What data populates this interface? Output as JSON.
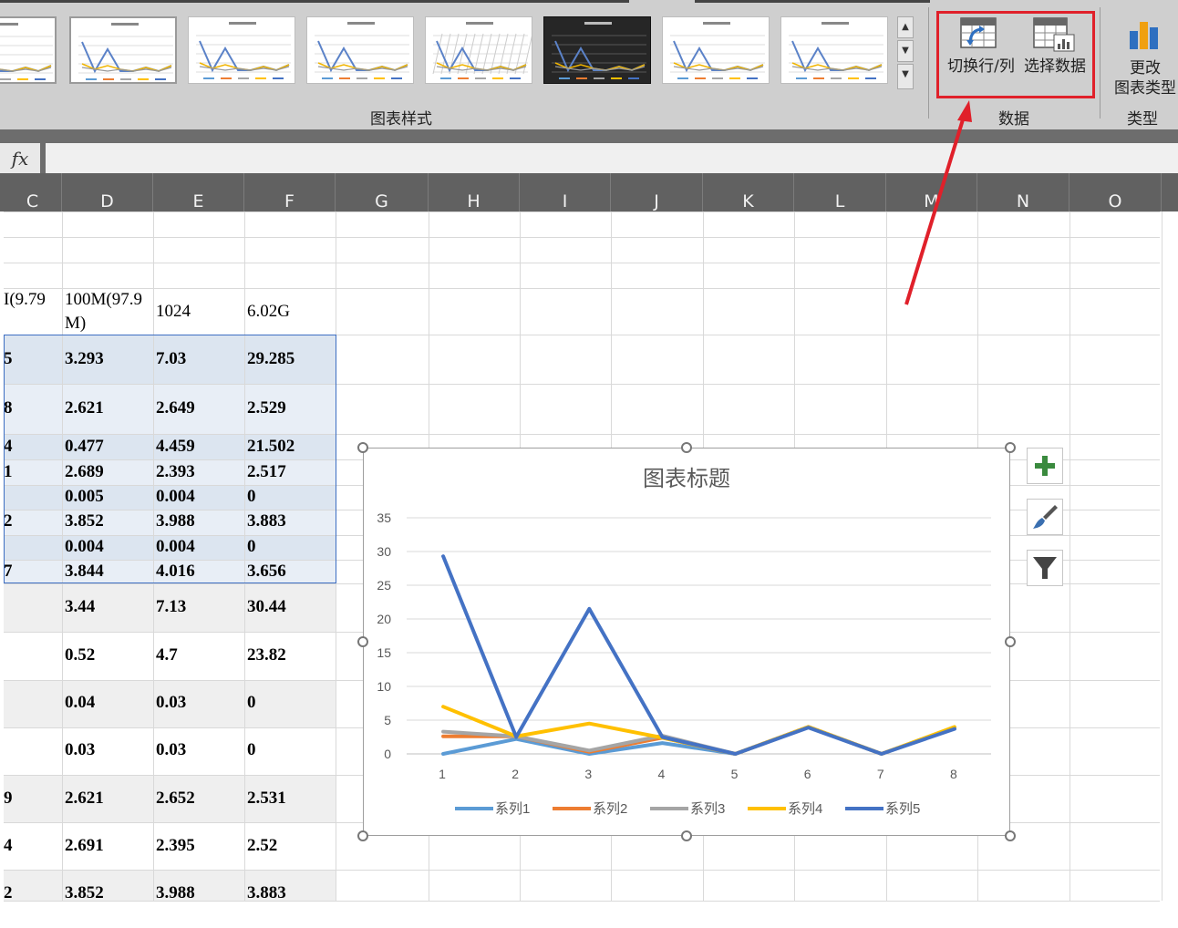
{
  "ribbon": {
    "chart_styles_group_label": "图表样式",
    "data_group_label": "数据",
    "type_group_label": "类型",
    "switch_row_col_label": "切换行/列",
    "select_data_label": "选择数据",
    "change_type_label_1": "更改",
    "change_type_label_2": "图表类型",
    "scroll_up_icon": "chevron-up-icon",
    "scroll_down_icon": "chevron-down-icon",
    "more_icon": "more-styles-icon",
    "highlight_color": "#e0202a"
  },
  "formula_bar": {
    "fx_label": "fx",
    "value": ""
  },
  "columns": [
    "C",
    "D",
    "E",
    "F",
    "G",
    "H",
    "I",
    "J",
    "K",
    "L",
    "M",
    "N",
    "O"
  ],
  "sheet": {
    "header_row": {
      "c": "I(9.79",
      "d1": "100M(97.9",
      "d2": "M)",
      "e": "1024",
      "f": "6.02G"
    },
    "rows": [
      {
        "c": "5",
        "d": "3.293",
        "e": "7.03",
        "f": "29.285"
      },
      {
        "c": "8",
        "d": "2.621",
        "e": "2.649",
        "f": "2.529"
      },
      {
        "c": "4",
        "d": "0.477",
        "e": "4.459",
        "f": "21.502"
      },
      {
        "c": "1",
        "d": "2.689",
        "e": "2.393",
        "f": "2.517"
      },
      {
        "c": "",
        "d": "0.005",
        "e": "0.004",
        "f": "0"
      },
      {
        "c": "2",
        "d": "3.852",
        "e": "3.988",
        "f": "3.883"
      },
      {
        "c": "",
        "d": "0.004",
        "e": "0.004",
        "f": "0"
      },
      {
        "c": "7",
        "d": "3.844",
        "e": "4.016",
        "f": "3.656"
      },
      {
        "c": "",
        "d": "3.44",
        "e": "7.13",
        "f": "30.44"
      },
      {
        "c": "",
        "d": "0.52",
        "e": "4.7",
        "f": "23.82"
      },
      {
        "c": "",
        "d": "0.04",
        "e": "0.03",
        "f": "0"
      },
      {
        "c": "",
        "d": "0.03",
        "e": "0.03",
        "f": "0"
      },
      {
        "c": "9",
        "d": "2.621",
        "e": "2.652",
        "f": "2.531"
      },
      {
        "c": "4",
        "d": "2.691",
        "e": "2.395",
        "f": "2.52"
      },
      {
        "c": "2",
        "d": "3.852",
        "e": "3.988",
        "f": "3.883"
      }
    ]
  },
  "chart_side_buttons": [
    {
      "name": "add-element-button",
      "icon": "plus-icon",
      "color": "#3a8a3e"
    },
    {
      "name": "chart-style-button",
      "icon": "paintbrush-icon",
      "color": "#3a6fb0"
    },
    {
      "name": "chart-filter-button",
      "icon": "filter-icon",
      "color": "#444444"
    }
  ],
  "chart_data": {
    "type": "line",
    "title": "图表标题",
    "categories": [
      "1",
      "2",
      "3",
      "4",
      "5",
      "6",
      "7",
      "8"
    ],
    "ylim": [
      0,
      35
    ],
    "yticks": [
      0,
      5,
      10,
      15,
      20,
      25,
      30,
      35
    ],
    "grid": true,
    "legend": "bottom",
    "series": [
      {
        "name": "系列1",
        "color": "#5b9bd5",
        "values": [
          0,
          2.2,
          0,
          1.6,
          0,
          4,
          0,
          3.8
        ]
      },
      {
        "name": "系列2",
        "color": "#ed7d31",
        "values": [
          2.6,
          2.6,
          0.3,
          2.4,
          0,
          4,
          0,
          3.9
        ]
      },
      {
        "name": "系列3",
        "color": "#a5a5a5",
        "values": [
          3.3,
          2.6,
          0.5,
          2.7,
          0,
          4,
          0,
          3.9
        ]
      },
      {
        "name": "系列4",
        "color": "#ffc000",
        "values": [
          7.0,
          2.6,
          4.5,
          2.4,
          0,
          4,
          0,
          4.0
        ]
      },
      {
        "name": "系列5",
        "color": "#4472c4",
        "values": [
          29.3,
          2.5,
          21.5,
          2.5,
          0,
          3.9,
          0,
          3.7
        ]
      }
    ]
  }
}
